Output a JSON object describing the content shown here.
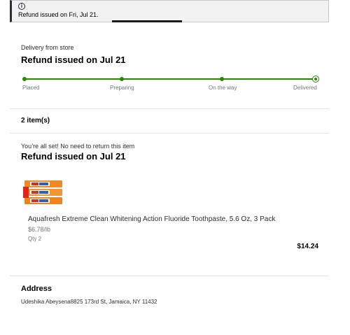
{
  "alert": {
    "icon": "info-icon",
    "text": "Refund issued on Fri, Jul 21."
  },
  "order": {
    "delivery_type": "Delivery from store",
    "status_title": "Refund issued on Jul 21",
    "progress_steps": [
      "Placed",
      "Preparing",
      "On the way",
      "Delivered"
    ],
    "progress_color": "#2a8703"
  },
  "items": {
    "count_label": "2 item(s)",
    "return_notice": "You’re all set! No need to return this item",
    "refund_title": "Refund issued on Jul 21"
  },
  "product": {
    "name": "Aquafresh Extreme Clean Whitening Action Fluoride Toothpaste, 5.6 Oz, 3 Pack",
    "unit_price": "$6.78/lb",
    "quantity": "Qty 2",
    "total": "$14.24"
  },
  "address": {
    "heading": "Address",
    "text": "Udeshika Abeysena8825 173rd St, Jamaica, NY 11432"
  }
}
